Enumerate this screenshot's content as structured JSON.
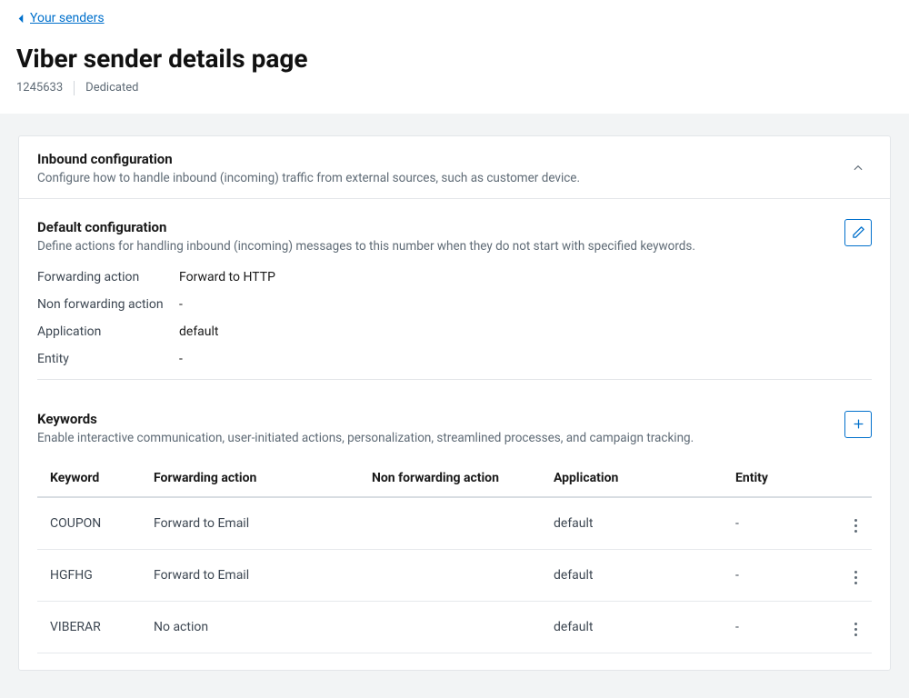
{
  "breadcrumb": {
    "label": "Your senders"
  },
  "page": {
    "title": "Viber sender details page",
    "id": "1245633",
    "type": "Dedicated"
  },
  "inbound": {
    "header_title": "Inbound configuration",
    "header_desc": "Configure how to handle inbound (incoming) traffic from external sources, such as customer device."
  },
  "default_config": {
    "title": "Default configuration",
    "desc": "Define actions for handling inbound (incoming) messages to this number when they do not start with specified keywords.",
    "rows": [
      {
        "label": "Forwarding action",
        "value": "Forward to HTTP"
      },
      {
        "label": "Non forwarding action",
        "value": "-"
      },
      {
        "label": "Application",
        "value": "default"
      },
      {
        "label": "Entity",
        "value": "-"
      }
    ]
  },
  "keywords": {
    "title": "Keywords",
    "desc": "Enable interactive communication, user-initiated actions, personalization, streamlined processes, and campaign tracking.",
    "columns": [
      "Keyword",
      "Forwarding action",
      "Non forwarding action",
      "Application",
      "Entity"
    ],
    "rows": [
      {
        "keyword": "COUPON",
        "fwd": "Forward to Email",
        "nonfwd": "",
        "app": "default",
        "entity": "-"
      },
      {
        "keyword": "HGFHG",
        "fwd": "Forward to Email",
        "nonfwd": "",
        "app": "default",
        "entity": "-"
      },
      {
        "keyword": "VIBERAR",
        "fwd": "No action",
        "nonfwd": "",
        "app": "default",
        "entity": "-"
      }
    ]
  }
}
